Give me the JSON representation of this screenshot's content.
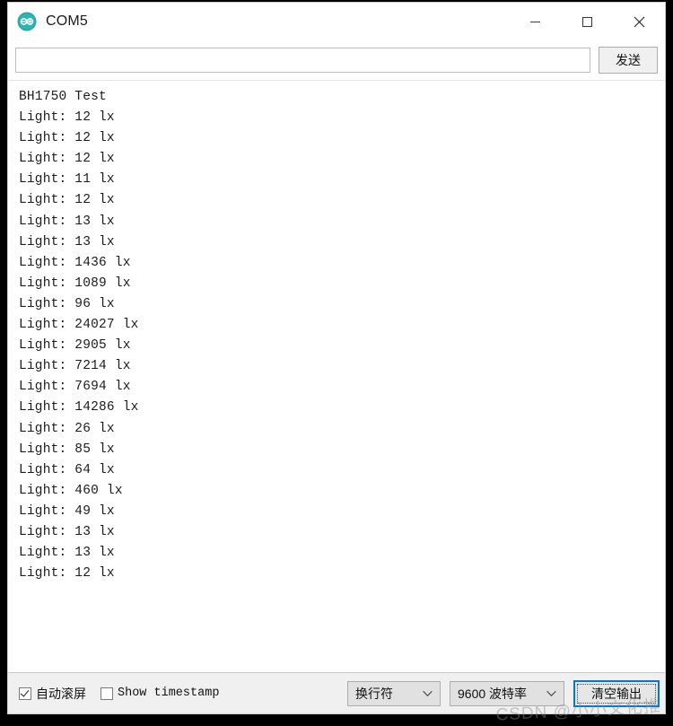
{
  "window": {
    "title": "COM5",
    "app_icon": "arduino-logo-icon",
    "accent_color": "#0078d7",
    "controls": {
      "minimize": "minimize-icon",
      "maximize": "maximize-icon",
      "close": "close-icon"
    }
  },
  "send_row": {
    "input_value": "",
    "input_placeholder": "",
    "send_label": "发送"
  },
  "console": {
    "lines": [
      "BH1750 Test",
      "Light: 12 lx",
      "Light: 12 lx",
      "Light: 12 lx",
      "Light: 11 lx",
      "Light: 12 lx",
      "Light: 13 lx",
      "Light: 13 lx",
      "Light: 1436 lx",
      "Light: 1089 lx",
      "Light: 96 lx",
      "Light: 24027 lx",
      "Light: 2905 lx",
      "Light: 7214 lx",
      "Light: 7694 lx",
      "Light: 14286 lx",
      "Light: 26 lx",
      "Light: 85 lx",
      "Light: 64 lx",
      "Light: 460 lx",
      "Light: 49 lx",
      "Light: 13 lx",
      "Light: 13 lx",
      "Light: 12 lx"
    ]
  },
  "statusbar": {
    "autoscroll": {
      "label": "自动滚屏",
      "checked": true
    },
    "show_timestamp": {
      "label": "Show timestamp",
      "checked": false
    },
    "line_ending": {
      "selected": "换行符"
    },
    "baud_rate": {
      "selected": "9600 波特率"
    },
    "clear_button": {
      "label": "清空输出"
    }
  },
  "watermark": {
    "text": "CSDN @小小文化推"
  }
}
